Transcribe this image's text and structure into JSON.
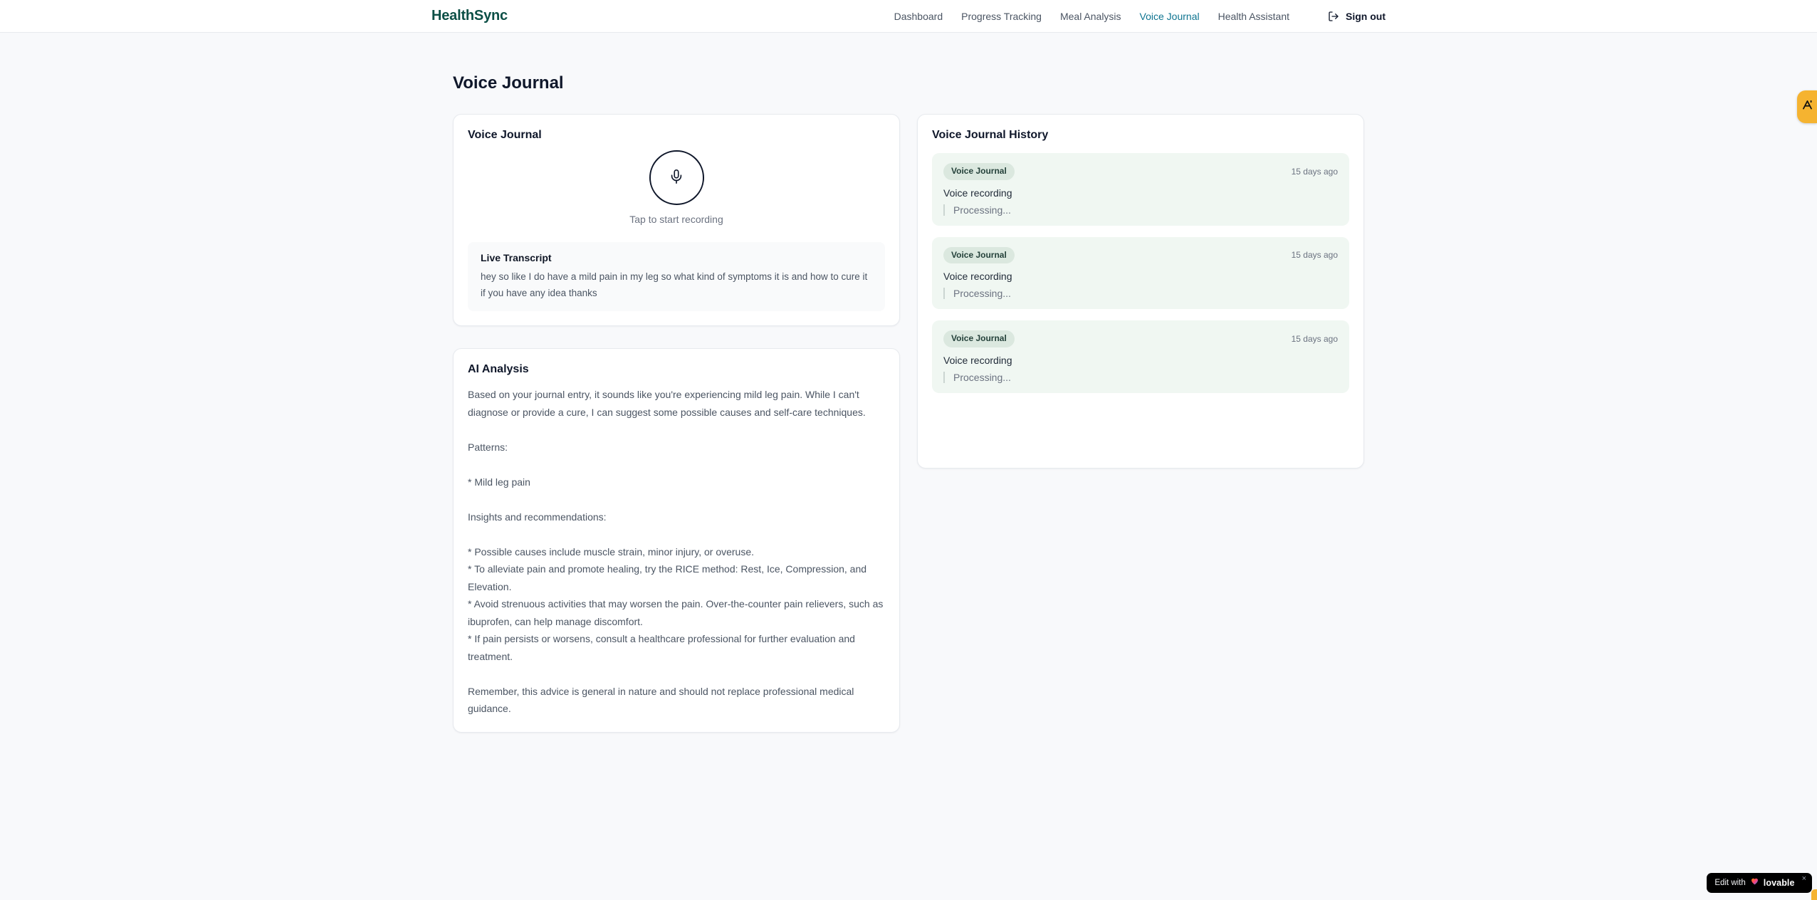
{
  "header": {
    "logo": "HealthSync",
    "nav_items": [
      {
        "label": "Dashboard"
      },
      {
        "label": "Progress Tracking"
      },
      {
        "label": "Meal Analysis"
      },
      {
        "label": "Voice Journal"
      },
      {
        "label": "Health Assistant"
      }
    ],
    "signout": {
      "label": "Sign out"
    }
  },
  "page": {
    "title": "Voice Journal"
  },
  "recorder_card": {
    "title": "Voice Journal",
    "tap_hint": "Tap to start recording",
    "transcript": {
      "title": "Live Transcript",
      "text": "hey so like I do have a mild pain in my leg so what kind of symptoms it is and how to cure it if you have any idea thanks"
    }
  },
  "analysis_card": {
    "title": "AI Analysis",
    "body": "Based on your journal entry, it sounds like you're experiencing mild leg pain. While I can't diagnose or provide a cure, I can suggest some possible causes and self-care techniques.\n\nPatterns:\n\n* Mild leg pain\n\nInsights and recommendations:\n\n* Possible causes include muscle strain, minor injury, or overuse.\n* To alleviate pain and promote healing, try the RICE method: Rest, Ice, Compression, and Elevation.\n* Avoid strenuous activities that may worsen the pain. Over-the-counter pain relievers, such as ibuprofen, can help manage discomfort.\n* If pain persists or worsens, consult a healthcare professional for further evaluation and treatment.\n\nRemember, this advice is general in nature and should not replace professional medical guidance."
  },
  "history_card": {
    "title": "Voice Journal History",
    "entries": [
      {
        "badge": "Voice Journal",
        "time": "15 days ago",
        "title": "Voice recording",
        "status": "Processing..."
      },
      {
        "badge": "Voice Journal",
        "time": "15 days ago",
        "title": "Voice recording",
        "status": "Processing..."
      },
      {
        "badge": "Voice Journal",
        "time": "15 days ago",
        "title": "Voice recording",
        "status": "Processing..."
      }
    ]
  },
  "floating": {
    "lovable": {
      "prefix": "Edit with",
      "brand": "lovable",
      "close": "×"
    }
  },
  "colors": {
    "brand_logo": "#0c4f46",
    "nav_active": "#0e7490",
    "page_background": "#f8f9fb",
    "history_entry_background": "#f0f7f2",
    "history_badge_background": "#dbe8df",
    "extension_badge": "#f5b330",
    "lovable_badge_background": "#000000"
  }
}
